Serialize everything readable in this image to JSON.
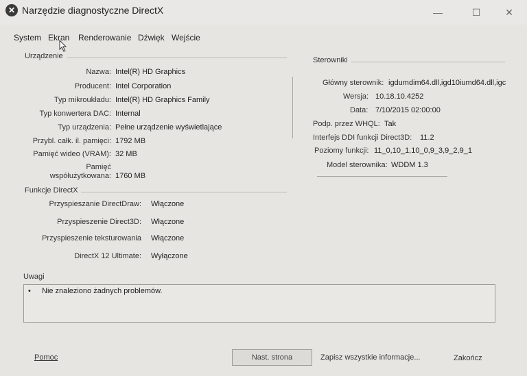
{
  "window": {
    "title": "Narzędzie diagnostyczne DirectX",
    "minimize": "—",
    "maximize": "☐",
    "close": "✕"
  },
  "tabs": [
    "System",
    "Ekran",
    "Renderowanie",
    "Dźwięk",
    "Wejście"
  ],
  "device": {
    "heading": "Urządzenie",
    "rows": [
      {
        "label": "Nazwa:",
        "value": "Intel(R) HD Graphics"
      },
      {
        "label": "Producent:",
        "value": "Intel Corporation"
      },
      {
        "label": "Typ mikroukładu:",
        "value": "Intel(R) HD Graphics Family"
      },
      {
        "label": "Typ konwertera DAC:",
        "value": "Internal"
      },
      {
        "label": "Typ urządzenia:",
        "value": "Pełne urządzenie wyświetlające"
      },
      {
        "label": "Przybl. całk. il. pamięci:",
        "value": "1792 MB"
      },
      {
        "label": "Pamięć wideo (VRAM):",
        "value": "32 MB"
      },
      {
        "label": "Pamięć\nwspółużytkowana:",
        "value": "1760 MB"
      }
    ]
  },
  "directx": {
    "heading": "Funkcje DirectX",
    "rows": [
      {
        "label": "Przyspieszanie DirectDraw:",
        "value": "Włączone"
      },
      {
        "label": "Przyspieszenie Direct3D:",
        "value": "Włączone"
      },
      {
        "label": "Przyspieszenie teksturowania",
        "value": "Włączone"
      },
      {
        "label": "DirectX 12 Ultimate:",
        "value": "Wyłączone"
      }
    ]
  },
  "drivers": {
    "heading": "Sterowniki",
    "rows": [
      {
        "label": "Główny sterownik:",
        "value": "igdumdim64.dll,igd10iumd64.dll,igc"
      },
      {
        "label": "Wersja:",
        "value": "10.18.10.4252"
      },
      {
        "label": "Data:",
        "value": "7/10/2015 02:00:00"
      },
      {
        "label": "Podp. przez WHQL:",
        "value": "Tak"
      },
      {
        "label": "Interfejs DDI funkcji Direct3D:",
        "value": "11.2"
      },
      {
        "label": "Poziomy funkcji:",
        "value": "11_0,10_1,10_0,9_3,9_2,9_1"
      },
      {
        "label": "Model sterownika:",
        "value": "WDDM 1.3"
      }
    ]
  },
  "notes": {
    "heading": "Uwagi",
    "bullet": "•",
    "items": [
      "Nie znaleziono żadnych problemów."
    ]
  },
  "footer": {
    "help": "Pomoc",
    "next": "Nast. strona",
    "save": "Zapisz wszystkie informacje...",
    "exit": "Zakończ"
  }
}
